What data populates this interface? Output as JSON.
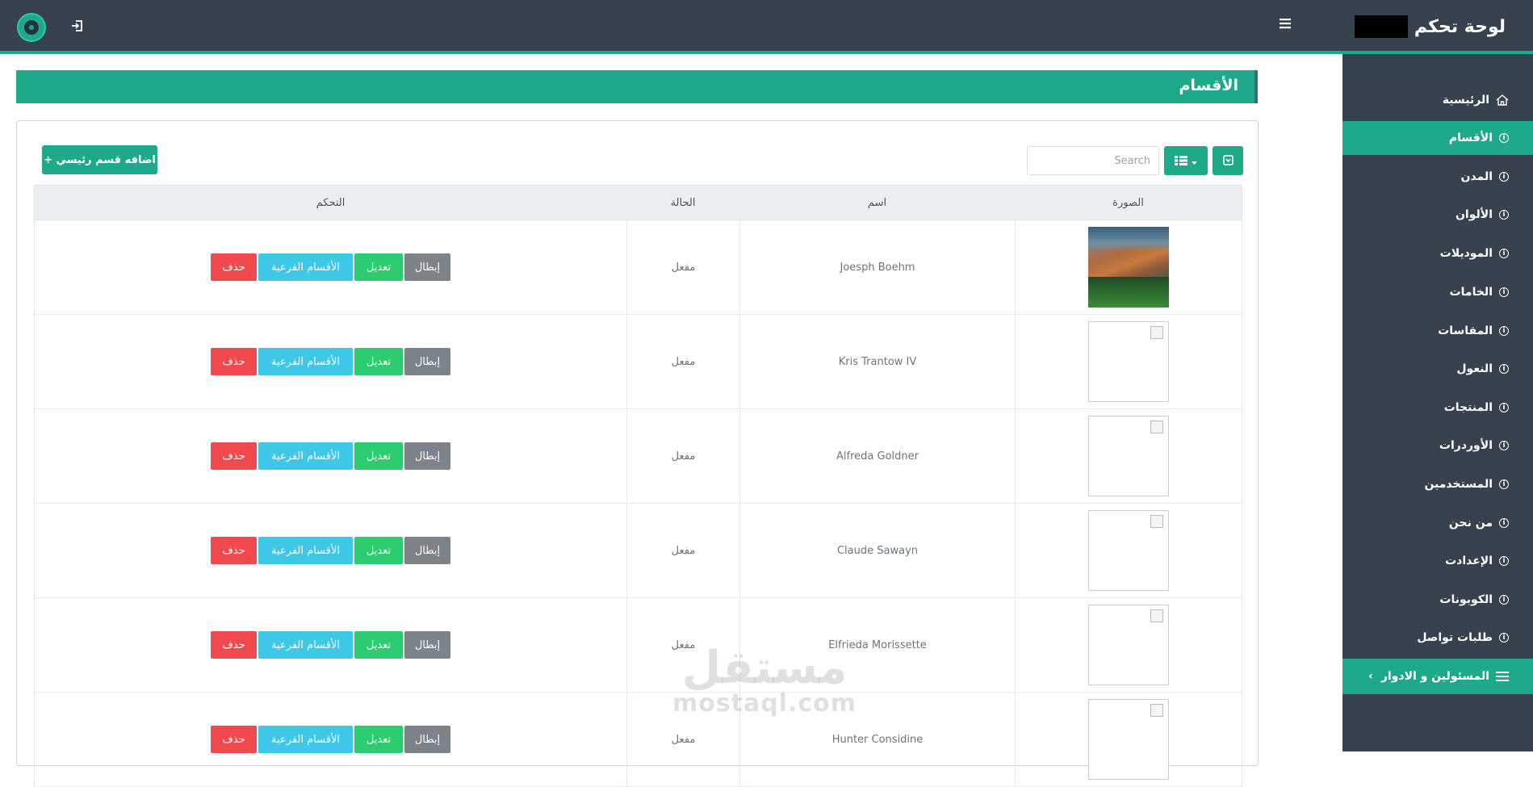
{
  "header": {
    "brand_title": "لوحة تحكم",
    "hamburger_icon": "menu-icon",
    "logout_icon": "logout-icon",
    "avatar_icon": "avatar-icon"
  },
  "sidebar": {
    "items": [
      {
        "label": "الرئيسية",
        "icon": "home-icon",
        "active": false
      },
      {
        "label": "الأقسام",
        "icon": "info-icon",
        "active": true
      },
      {
        "label": "المدن",
        "icon": "info-icon",
        "active": false
      },
      {
        "label": "الألوان",
        "icon": "info-icon",
        "active": false
      },
      {
        "label": "الموديلات",
        "icon": "info-icon",
        "active": false
      },
      {
        "label": "الخامات",
        "icon": "info-icon",
        "active": false
      },
      {
        "label": "المقاسات",
        "icon": "info-icon",
        "active": false
      },
      {
        "label": "النعول",
        "icon": "info-icon",
        "active": false
      },
      {
        "label": "المنتجات",
        "icon": "info-icon",
        "active": false
      },
      {
        "label": "الأوردرات",
        "icon": "info-icon",
        "active": false
      },
      {
        "label": "المستخدمين",
        "icon": "info-icon",
        "active": false
      },
      {
        "label": "من نحن",
        "icon": "info-icon",
        "active": false
      },
      {
        "label": "الإعدادت",
        "icon": "info-icon",
        "active": false
      },
      {
        "label": "الكوبونات",
        "icon": "info-icon",
        "active": false
      },
      {
        "label": "طلبات تواصل",
        "icon": "info-icon",
        "active": false
      },
      {
        "label": "المسئولين و الادوار",
        "icon": "list-icon",
        "active": true,
        "chevron": "‹"
      }
    ]
  },
  "page": {
    "title": "الأقسام"
  },
  "toolbar": {
    "add_label": "اضافه قسم رئيسي +",
    "search_placeholder": "Search",
    "columns_icon": "columns-icon",
    "export_icon": "export-icon"
  },
  "table": {
    "headers": {
      "image": "الصورة",
      "name": "اسم",
      "status": "الحالة",
      "control": "التحكم"
    },
    "action_labels": {
      "disable": "إبطال",
      "edit": "تعديل",
      "subcategories": "الأقسام الفرعية",
      "delete": "حذف"
    },
    "rows": [
      {
        "name": "Joesph Boehm",
        "status": "مفعل",
        "image": "photo"
      },
      {
        "name": "Kris Trantow IV",
        "status": "مفعل",
        "image": "broken"
      },
      {
        "name": "Alfreda Goldner",
        "status": "مفعل",
        "image": "broken"
      },
      {
        "name": "Claude Sawayn",
        "status": "مفعل",
        "image": "broken"
      },
      {
        "name": "Elfrieda Morissette",
        "status": "مفعل",
        "image": "broken"
      },
      {
        "name": "Hunter Considine",
        "status": "مفعل",
        "image": "broken"
      }
    ]
  },
  "watermark": {
    "arabic": "مستقل",
    "latin": "mostaql.com"
  },
  "colors": {
    "topbar": "#37424e",
    "accent": "#1fa98b",
    "disable": "#7c8389",
    "edit": "#2ecc71",
    "subcategories": "#3ec7e6",
    "delete": "#f04a4e"
  }
}
